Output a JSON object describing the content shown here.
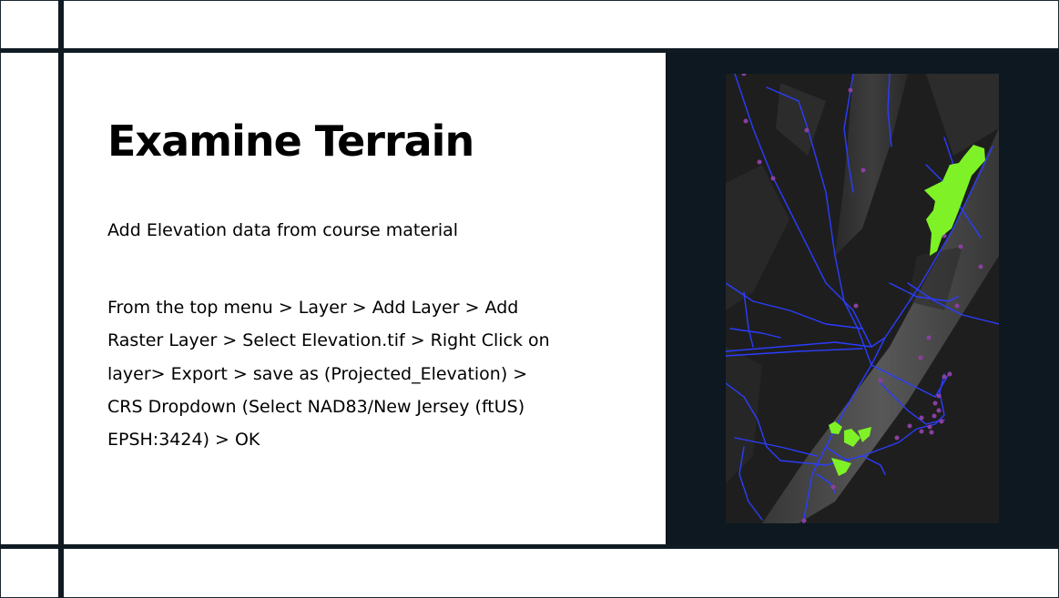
{
  "slide": {
    "title": "Examine Terrain",
    "subtitle": "Add Elevation data from course material",
    "instruction_lines": [
      "From the top menu > Layer > Add Layer > Add",
      "Raster Layer > Select Elevation.tif > Right Click on",
      "layer>  Export > save as (Projected_Elevation) >",
      "CRS Dropdown (Select NAD83/New Jersey (ftUS)",
      "EPSH:3424) > OK"
    ]
  },
  "colors": {
    "frame_lines": "#0f1a22",
    "panel_background": "#0d1820",
    "roads": "#2b3dff",
    "points": "#8a3fa0",
    "parcels": "#7ef227"
  },
  "map": {
    "layers": [
      "elevation-raster",
      "roads",
      "points",
      "parcels"
    ]
  }
}
